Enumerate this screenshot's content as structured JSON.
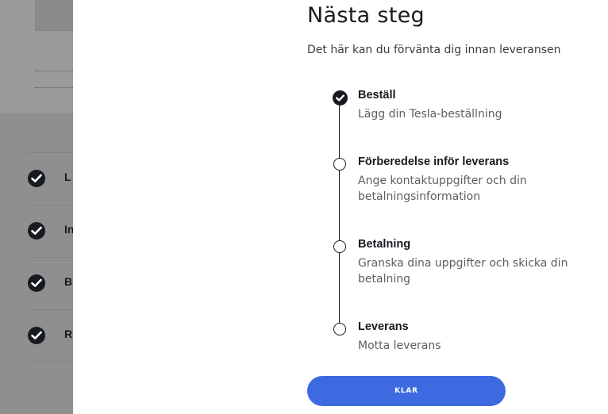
{
  "background_page": {
    "rows": [
      {
        "label": "L"
      },
      {
        "label": "In"
      },
      {
        "label": "B"
      },
      {
        "label": "R"
      }
    ]
  },
  "modal": {
    "title": "Nästa steg",
    "subtitle": "Det här kan du förvänta dig innan leveransen",
    "steps": [
      {
        "title": "Beställ",
        "description": "Lägg din Tesla-beställning",
        "status": "completed"
      },
      {
        "title": "Förberedelse inför leverans",
        "description": "Ange kontaktuppgifter och din betalningsinformation",
        "status": "pending"
      },
      {
        "title": "Betalning",
        "description": "Granska dina uppgifter och skicka din betalning",
        "status": "pending"
      },
      {
        "title": "Leverans",
        "description": "Motta leverans",
        "status": "pending"
      }
    ],
    "done_label": "KLAR"
  },
  "colors": {
    "primary_button": "#3e6ae1",
    "text_dark": "#171a20",
    "text_muted": "#5c5e62",
    "overlay_gray": "#8f8f8f"
  },
  "icons": {
    "completed_step": "check-circle-icon",
    "pending_step": "empty-circle-icon"
  }
}
